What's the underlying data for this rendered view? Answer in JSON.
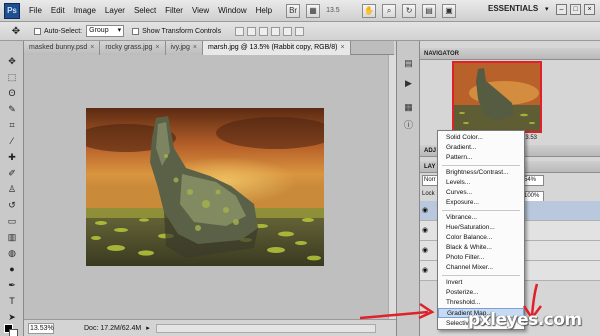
{
  "app": {
    "logo": "Ps",
    "menus": [
      "File",
      "Edit",
      "Image",
      "Layer",
      "Select",
      "Filter",
      "View",
      "Window",
      "Help"
    ],
    "zoom_display": "13.5",
    "workspace": "ESSENTIALS",
    "workspace_arrow": "▾"
  },
  "options_bar": {
    "auto_select_label": "Auto-Select:",
    "auto_select_value": "Group",
    "show_transform_label": "Show Transform Controls"
  },
  "tabs": [
    {
      "label": "masked bunny.psd",
      "close": "×"
    },
    {
      "label": "rocky grass.jpg",
      "close": "×"
    },
    {
      "label": "ivy.jpg",
      "close": "×"
    },
    {
      "label": "marsh.jpg @ 13.5% (Rabbit copy, RGB/8)",
      "close": "×"
    }
  ],
  "status": {
    "zoom": "13.53%",
    "doc_info": "Doc: 17.2M/62.4M",
    "arrow": "▸"
  },
  "panels": {
    "navigator_title": "NAVIGATOR",
    "navigator_zoom": "13.53",
    "adjustments_title": "ADJ",
    "layers_title": "LAY",
    "blend_mode": "Norr",
    "opacity": "54%",
    "lock_label": "Lock",
    "fill": "100%"
  },
  "context_menu": {
    "items": [
      "Solid Color...",
      "Gradient...",
      "Pattern...",
      "Brightness/Contrast...",
      "Levels...",
      "Curves...",
      "Exposure...",
      "Vibrance...",
      "Hue/Saturation...",
      "Color Balance...",
      "Black & White...",
      "Photo Filter...",
      "Channel Mixer...",
      "Invert",
      "Posterize...",
      "Threshold...",
      "Gradient Map...",
      "Selective Color..."
    ],
    "highlighted": "Gradient Map..."
  },
  "watermark": "pxleyes.com",
  "colors": {
    "accent_red": "#e0202a",
    "highlight": "#c7daf2",
    "sky_orange": "#c8722a"
  },
  "icons": {
    "move_tool": "move-icon",
    "hand": "hand-icon",
    "zoom": "zoom-icon"
  }
}
